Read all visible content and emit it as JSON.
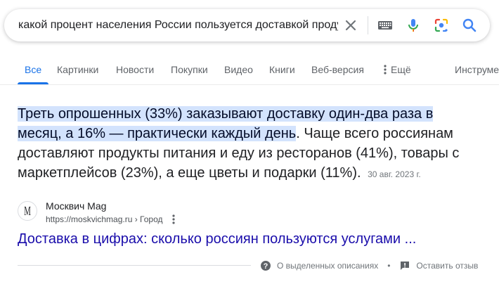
{
  "search": {
    "query": "какой процент населения России пользуется доставкой продуктов"
  },
  "tabs": [
    {
      "label": "Все",
      "active": true
    },
    {
      "label": "Картинки"
    },
    {
      "label": "Новости"
    },
    {
      "label": "Покупки"
    },
    {
      "label": "Видео"
    },
    {
      "label": "Книги"
    },
    {
      "label": "Веб-версия"
    },
    {
      "label": "Ещё"
    },
    {
      "label": "Инструменты"
    }
  ],
  "snippet": {
    "highlighted": "Треть опрошенных (33%) заказывают доставку один-два раза в месяц, а 16% — практически каждый день",
    "rest": ". Чаще всего россиянам доставляют продукты питания и еду из ресторанов (41%), товары с маркетплейсов (23%), а еще цветы и подарки (11%).",
    "date": "30 авг. 2023 г."
  },
  "source": {
    "favicon_letter": "M",
    "site_name": "Москвич Mag",
    "url": "https://moskvichmag.ru › Город"
  },
  "result": {
    "title": "Доставка в цифрах: сколько россиян пользуются услугами ..."
  },
  "footer": {
    "about": "О выделенных описаниях",
    "separator": "•",
    "feedback": "Оставить отзыв"
  },
  "colors": {
    "accent": "#1a73e8",
    "link": "#1a0dab",
    "highlight": "#d3e3fd"
  },
  "icons": [
    "close-icon",
    "keyboard-icon",
    "mic-icon",
    "lens-icon",
    "search-icon",
    "more-vert-icon",
    "help-icon",
    "feedback-icon"
  ]
}
